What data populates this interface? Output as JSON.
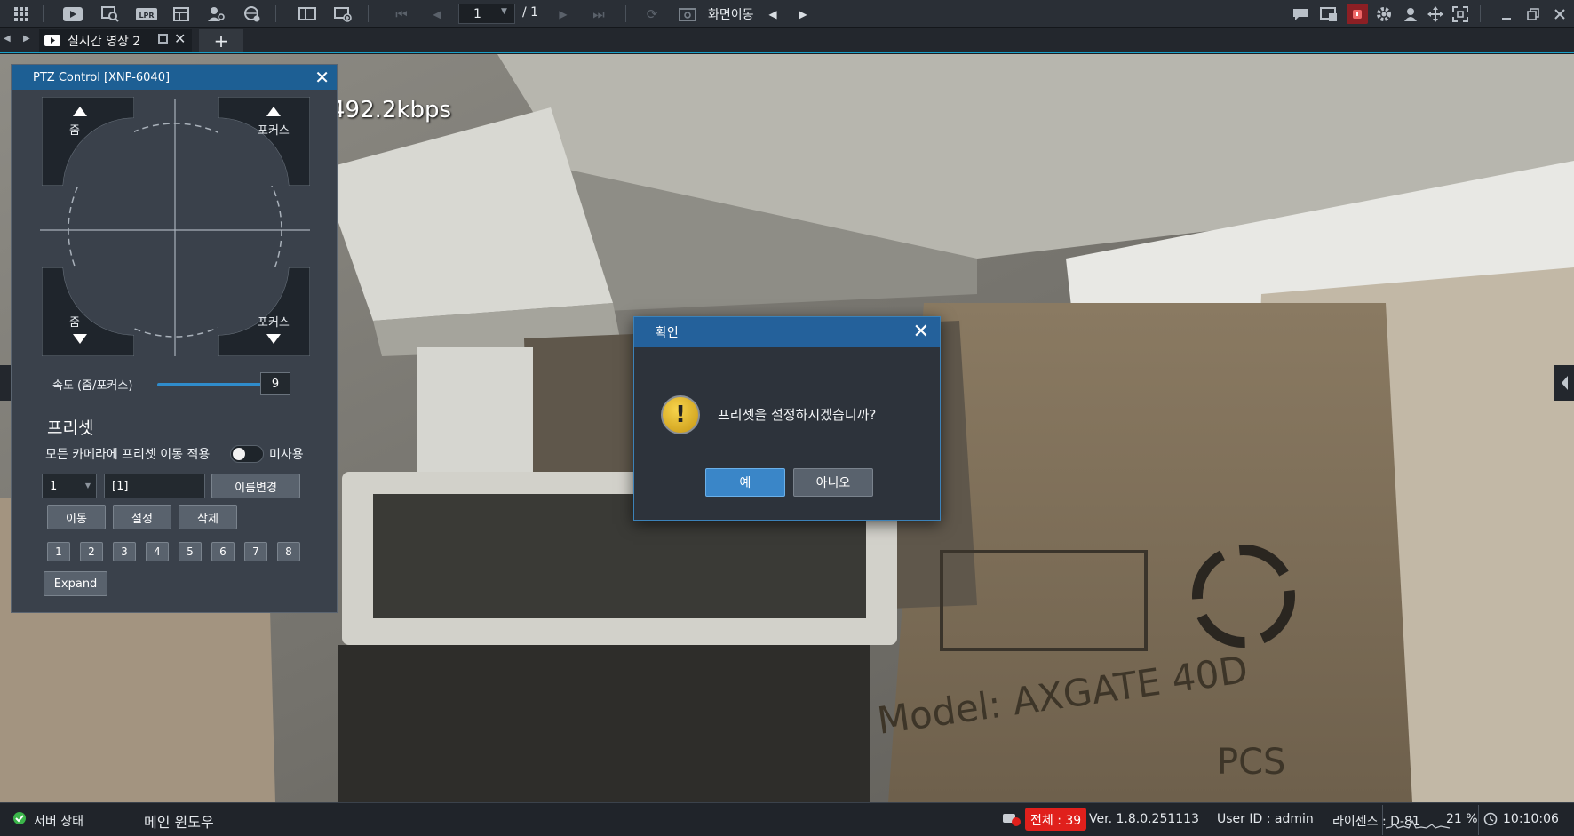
{
  "toolbar": {
    "page_current": "1",
    "page_total": "/ 1",
    "screen_move_label": "화면이동"
  },
  "tab": {
    "label": "실시간 영상 2"
  },
  "video": {
    "bitrate": "492.2kbps"
  },
  "ptz": {
    "title": "PTZ Control  [XNP-6040]",
    "zoom_in": "줌",
    "focus_near": "포커스",
    "zoom_out": "줌",
    "focus_far": "포커스",
    "speed_label": "속도 (줌/포커스)",
    "speed_value": "9",
    "preset_title": "프리셋",
    "apply_all_label": "모든 카메라에 프리셋 이동 적용",
    "toggle_label": "미사용",
    "preset_number": "1",
    "preset_name": "[1]",
    "rename_button": "이름변경",
    "move_button": "이동",
    "set_button": "설정",
    "delete_button": "삭제",
    "preset_buttons": [
      "1",
      "2",
      "3",
      "4",
      "5",
      "6",
      "7",
      "8"
    ],
    "expand_button": "Expand"
  },
  "dialog": {
    "title": "확인",
    "message": "프리셋을 설정하시겠습니까?",
    "yes_button": "예",
    "no_button": "아니오"
  },
  "status": {
    "server_status": "서버 상태",
    "main_window": "메인 윈도우",
    "total_badge": "전체 : 39",
    "version": "Ver. 1.8.0.251113",
    "user_id": "User ID : admin",
    "license": "라이센스 : D-81",
    "cpu": "21 %",
    "time": "10:10:06"
  },
  "colors": {
    "accent": "#1aa0c8",
    "dialog_header": "#24619b",
    "primary_button": "#3a86c8",
    "alert_badge": "#e0201c"
  }
}
